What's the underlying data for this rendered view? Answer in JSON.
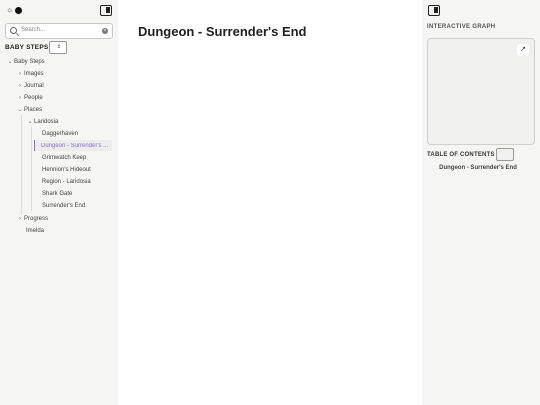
{
  "sidebar": {
    "theme_sun": "☼",
    "search": {
      "placeholder": "Search...",
      "clear": "×"
    },
    "vault_title": "BABY STEPS",
    "collapse_glyphs": [
      "⌄",
      "⌃"
    ],
    "tree": {
      "root": "Baby Steps",
      "items": {
        "images": "Images",
        "journal": "Journal",
        "people": "People",
        "places": "Places",
        "laridosia": "Laridosia",
        "daggerhaven": "Daggerhaven",
        "dungeon": "Dungeon - Surrender's ...",
        "grimwatch": "Grimwatch Keep",
        "hennion": "Hennion's Hideout",
        "region": "Region - Laridosia",
        "shark": "Shark Gate",
        "surrender": "Surrender's End",
        "progress": "Progress",
        "imelda": "Imelda"
      },
      "chevron_open": "⌄",
      "chevron_closed": "›"
    },
    "accent_color": "#8a6bd9"
  },
  "main": {
    "title": "Dungeon - Surrender's End"
  },
  "right_panel": {
    "graph_title": "INTERACTIVE GRAPH",
    "expand_glyph": "↗",
    "toc_title": "TABLE OF CONTENTS",
    "toc_items": [
      "Dungeon - Surrender's End"
    ]
  }
}
